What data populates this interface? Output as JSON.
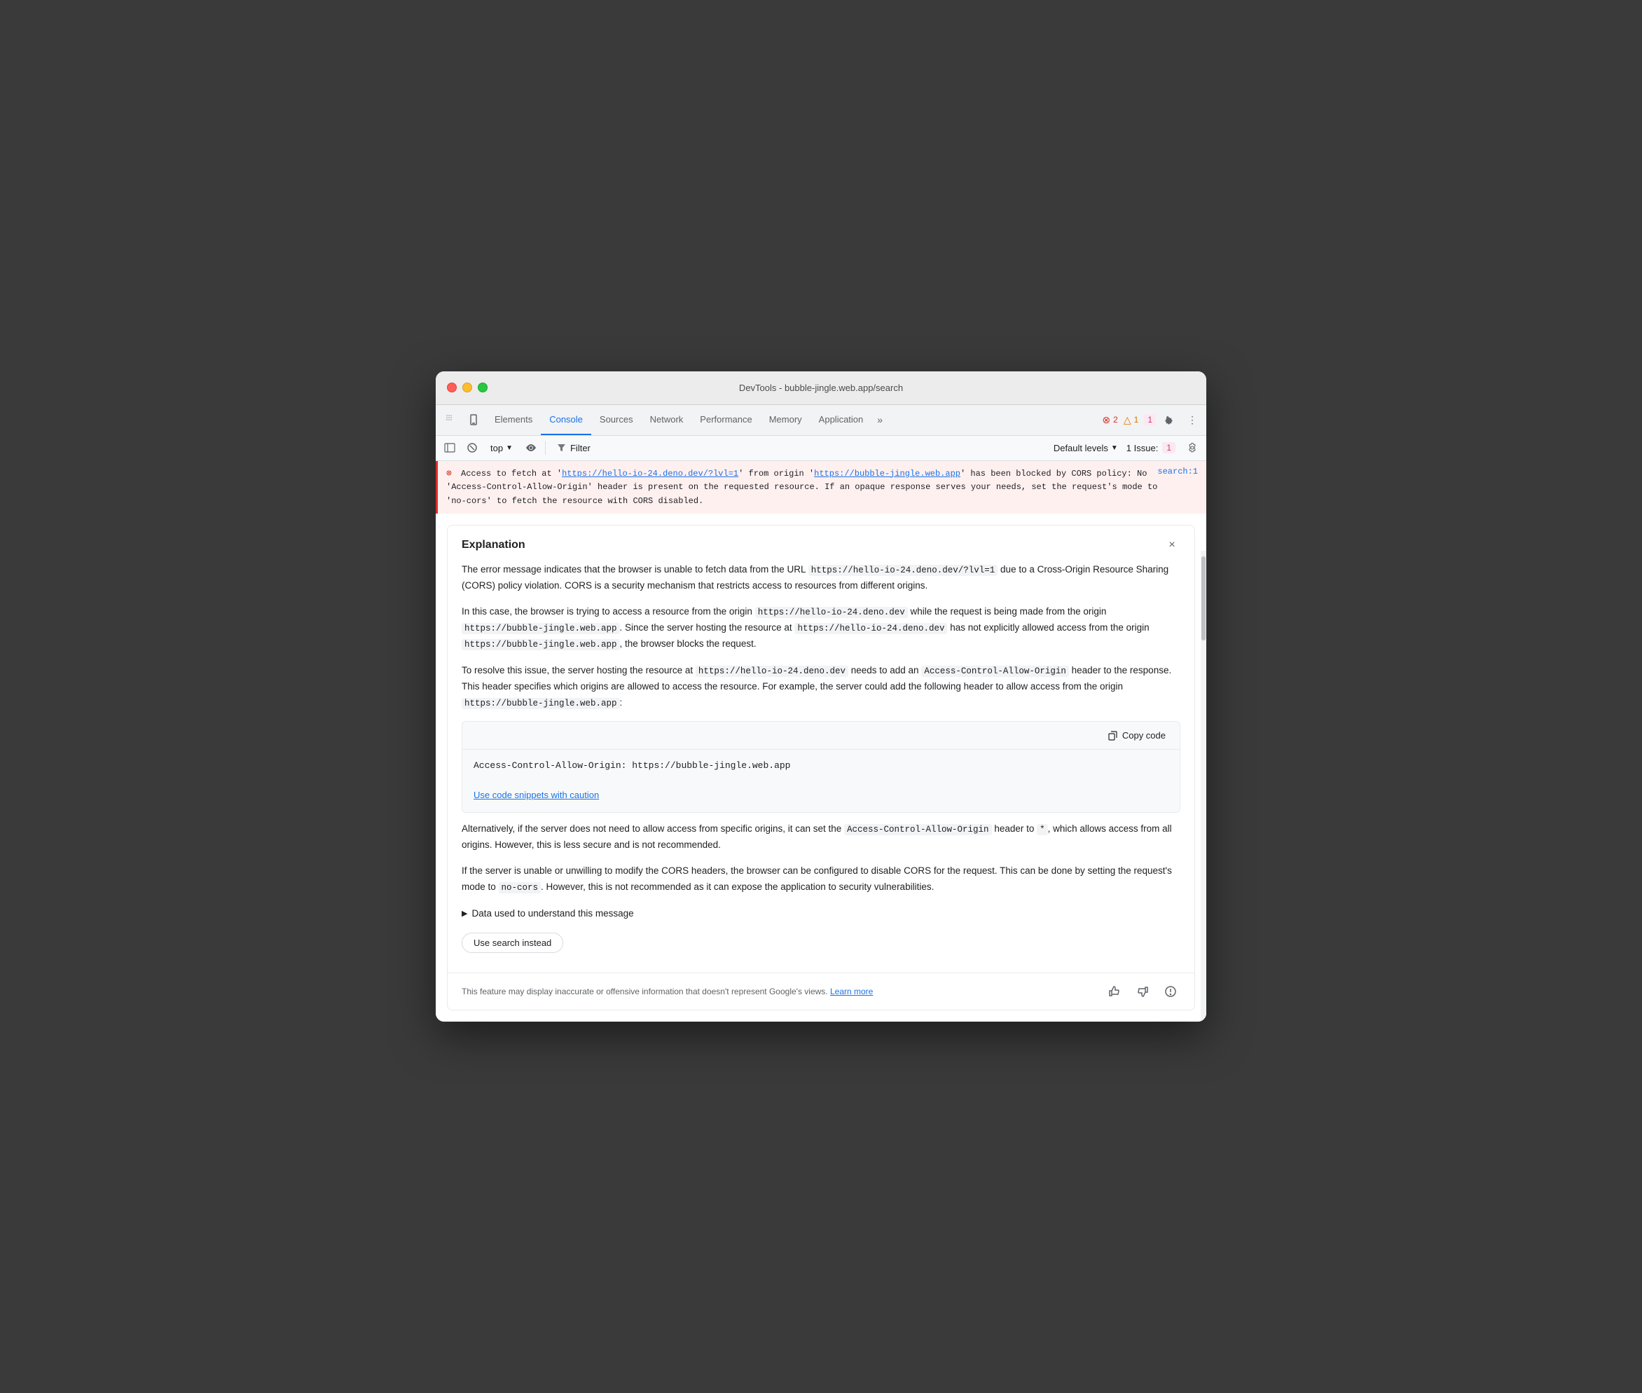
{
  "window": {
    "title": "DevTools - bubble-jingle.web.app/search"
  },
  "tabs": {
    "items": [
      {
        "label": "Elements",
        "active": false
      },
      {
        "label": "Console",
        "active": true
      },
      {
        "label": "Sources",
        "active": false
      },
      {
        "label": "Network",
        "active": false
      },
      {
        "label": "Performance",
        "active": false
      },
      {
        "label": "Memory",
        "active": false
      },
      {
        "label": "Application",
        "active": false
      }
    ],
    "more_label": "»"
  },
  "toolbar": {
    "top_label": "top",
    "filter_label": "Filter",
    "default_levels_label": "Default levels",
    "issues_label": "1 Issue:",
    "error_count": "2",
    "warning_count": "1",
    "issues_count": "1"
  },
  "error": {
    "icon": "✕",
    "text_part1": "Access to fetch at '",
    "url1": "https://hello-io-24.deno.dev/?lvl=1",
    "text_part2": "' from origin '",
    "url2": "https://bubble-jingle.web.app",
    "text_part3": "' has been blocked by CORS policy: No 'Access-Control-Allow-Origin' header is present on the requested resource. If an opaque response serves your needs, set the request's mode to 'no-cors' to fetch the resource with CORS disabled.",
    "source": "search:1"
  },
  "explanation": {
    "title": "Explanation",
    "close_label": "×",
    "paragraphs": {
      "p1": "The error message indicates that the browser is unable to fetch data from the URL",
      "p1_url": "https://hello-io-24.deno.dev/?lvl=1",
      "p1_rest": "due to a Cross-Origin Resource Sharing (CORS) policy violation. CORS is a security mechanism that restricts access to resources from different origins.",
      "p2": "In this case, the browser is trying to access a resource from the origin",
      "p2_code1": "https://hello-io-24.deno.dev",
      "p2_mid": "while the request is being made from the origin",
      "p2_code2": "https://bubble-jingle.web.app",
      "p2_rest": ". Since the server hosting the resource at",
      "p2_code3": "https://hello-io-24.deno.dev",
      "p2_rest2": "has not explicitly allowed access from the origin",
      "p2_code4": "https://bubble-jingle.web.app",
      "p2_rest3": ", the browser blocks the request.",
      "p3": "To resolve this issue, the server hosting the resource at",
      "p3_code1": "https://hello-io-24.deno.dev",
      "p3_mid": "needs to add an",
      "p3_code2": "Access-Control-Allow-Origin",
      "p3_rest": "header to the response. This header specifies which origins are allowed to access the resource. For example, the server could add the following header to allow access from the origin",
      "p3_code3": "https://bubble-jingle.web.app",
      "p3_rest2": ":"
    },
    "code_block": {
      "copy_label": "Copy code",
      "code": "Access-Control-Allow-Origin: https://bubble-jingle.web.app"
    },
    "caution_label": "Use code snippets with caution",
    "p4": "Alternatively, if the server does not need to allow access from specific origins, it can set the",
    "p4_code1": "Access-Control-Allow-Origin",
    "p4_mid": "header to",
    "p4_code2": "*",
    "p4_rest": ", which allows access from all origins. However, this is less secure and is not recommended.",
    "p5": "If the server is unable or unwilling to modify the CORS headers, the browser can be configured to disable CORS for the request. This can be done by setting the request's mode to",
    "p5_code": "no-cors",
    "p5_rest": ". However, this is not recommended as it can expose the application to security vulnerabilities.",
    "data_used_label": "Data used to understand this message",
    "use_search_label": "Use search instead",
    "disclaimer_text": "This feature may display inaccurate or offensive information that doesn't represent Google's views.",
    "learn_more_label": "Learn more"
  }
}
